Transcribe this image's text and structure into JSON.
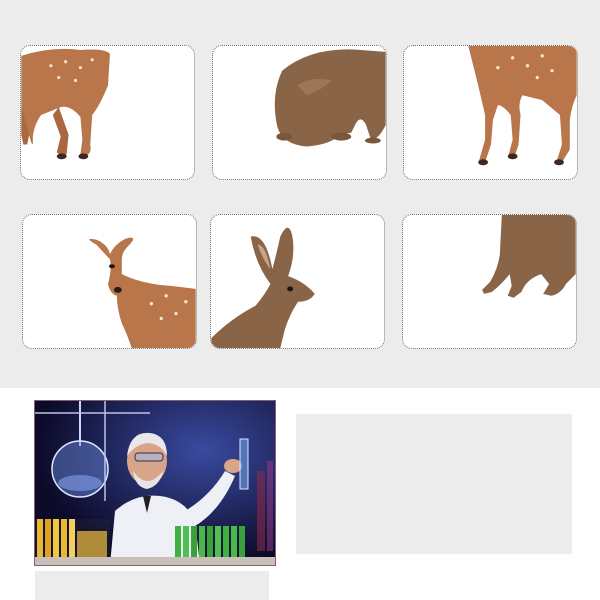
{
  "gallery": {
    "tiles": [
      {
        "subject": "deer-legs-top-view"
      },
      {
        "subject": "hare-crouching"
      },
      {
        "subject": "deer-legs-side-view"
      },
      {
        "subject": "fawn-head"
      },
      {
        "subject": "hare-head"
      },
      {
        "subject": "hare-legs"
      }
    ]
  },
  "lab_photo": {
    "subject": "scientist-in-laboratory"
  },
  "colors": {
    "panel": "#ececec",
    "deer": "#b8764a",
    "hare": "#8a6446",
    "tile_border": "#6d6d6d"
  }
}
